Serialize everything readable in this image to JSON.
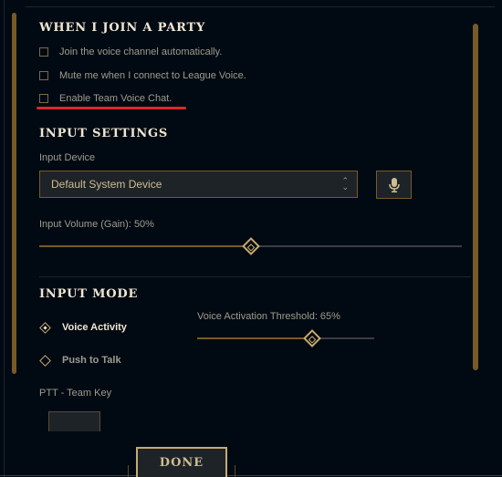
{
  "party": {
    "heading": "WHEN I JOIN A PARTY",
    "options": [
      {
        "label": "Join the voice channel automatically.",
        "checked": false
      },
      {
        "label": "Mute me when I connect to League Voice.",
        "checked": false
      },
      {
        "label": "Enable Team Voice Chat.",
        "checked": false
      }
    ],
    "highlight_color": "#e0262c"
  },
  "input": {
    "heading": "INPUT SETTINGS",
    "device_label": "Input Device",
    "device_value": "Default System Device",
    "mic_icon": "microphone-icon",
    "volume_label": "Input Volume (Gain): 50%",
    "volume_value": 0.5
  },
  "mode": {
    "heading": "INPUT MODE",
    "options": [
      {
        "label": "Voice Activity",
        "selected": true
      },
      {
        "label": "Push to Talk",
        "selected": false
      }
    ],
    "threshold_label": "Voice Activation Threshold: 65%",
    "threshold_value": 0.65,
    "ptt_label": "PTT - Team Key"
  },
  "footer": {
    "done_label": "DONE"
  },
  "colors": {
    "background": "#010a13",
    "gold": "#c8aa6e",
    "gold_dark": "#785a28",
    "heading": "#f0e6d2",
    "text": "#a09b8c"
  }
}
